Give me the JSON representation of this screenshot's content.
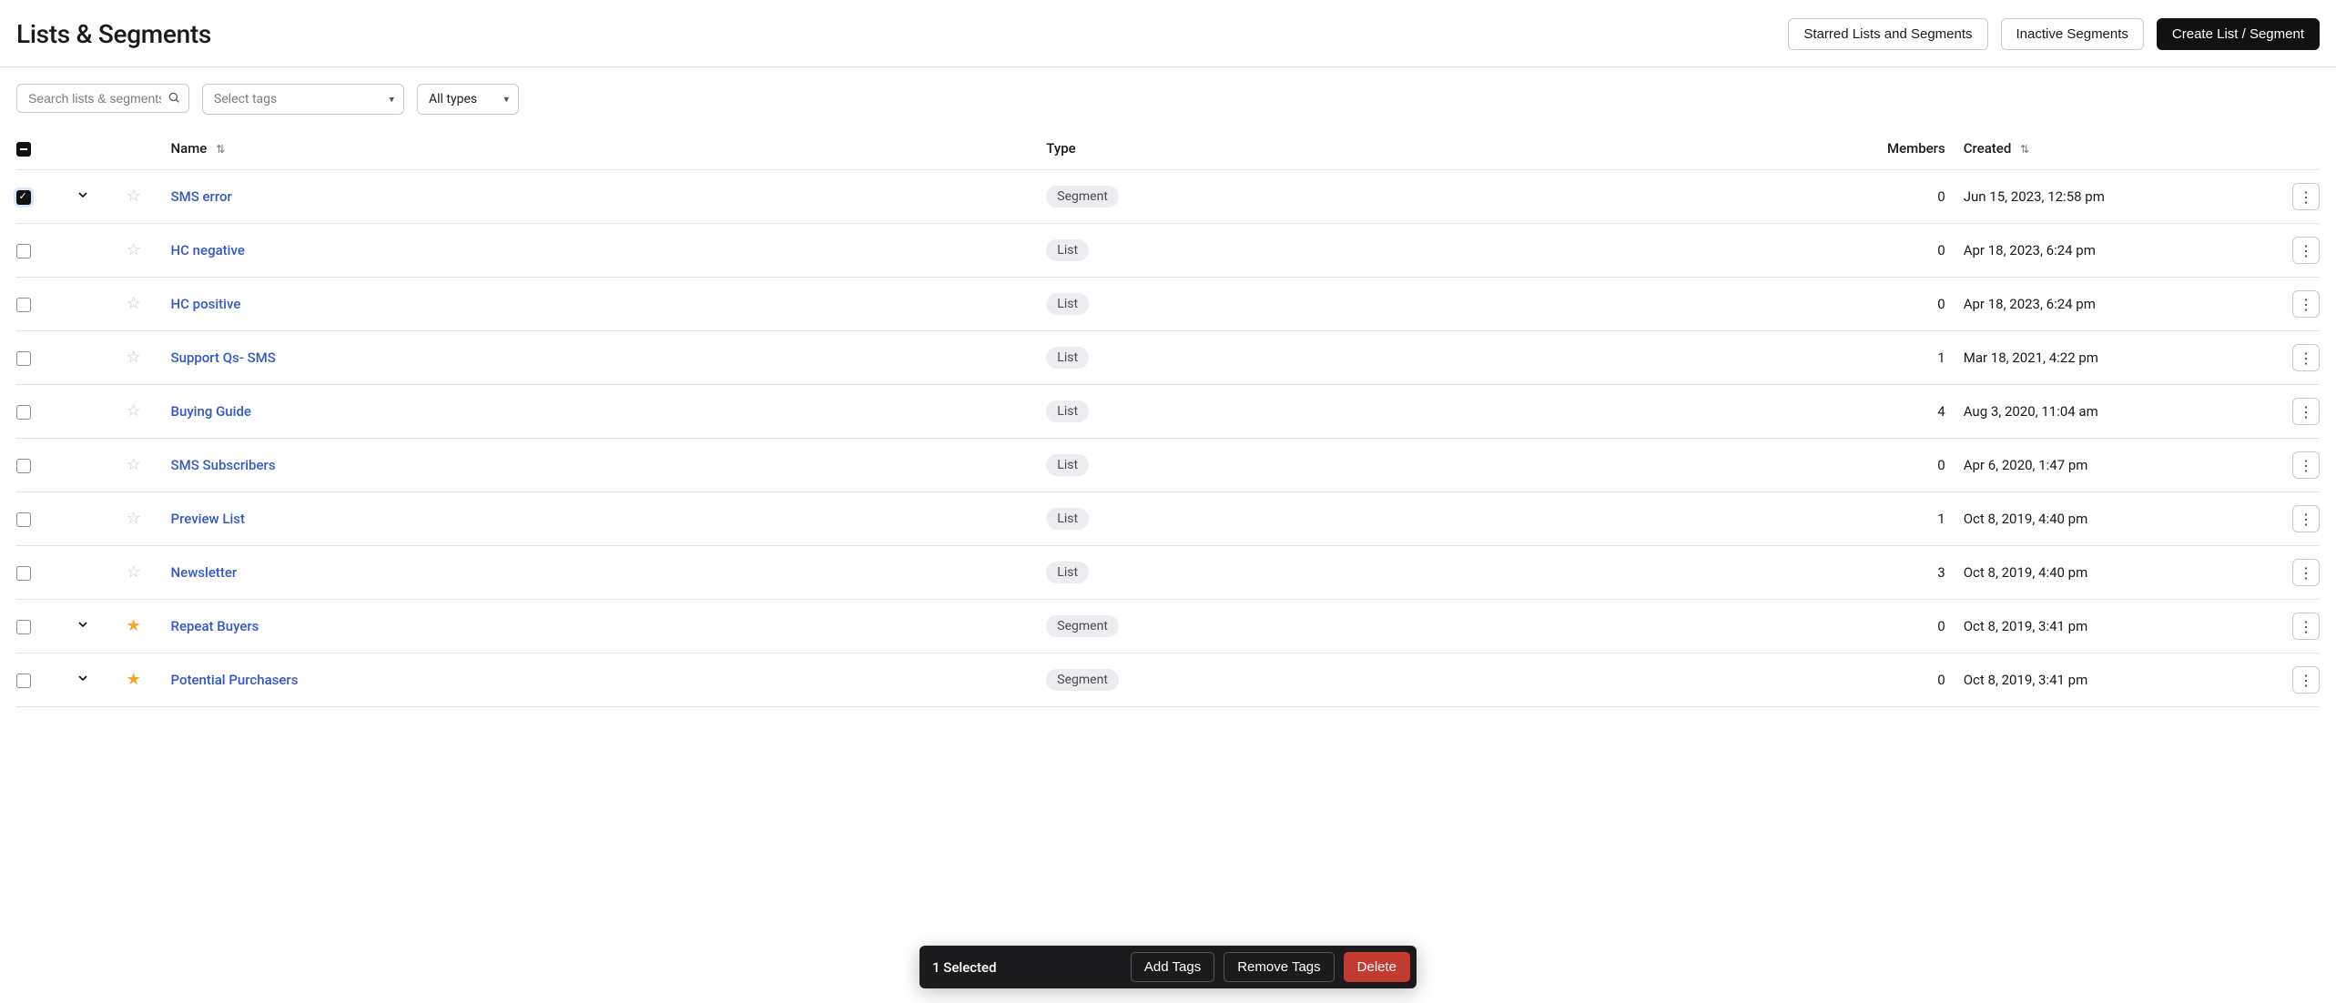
{
  "header": {
    "title": "Lists & Segments",
    "starred_btn": "Starred Lists and Segments",
    "inactive_btn": "Inactive Segments",
    "create_btn": "Create List / Segment"
  },
  "filters": {
    "search_placeholder": "Search lists & segments",
    "tags_placeholder": "Select tags",
    "types_label": "All types"
  },
  "columns": {
    "name": "Name",
    "type": "Type",
    "members": "Members",
    "created": "Created"
  },
  "rows": [
    {
      "selected": true,
      "expandable": true,
      "starred": false,
      "name": "SMS error",
      "type": "Segment",
      "members": "0",
      "created": "Jun 15, 2023, 12:58 pm"
    },
    {
      "selected": false,
      "expandable": false,
      "starred": false,
      "name": "HC negative",
      "type": "List",
      "members": "0",
      "created": "Apr 18, 2023, 6:24 pm"
    },
    {
      "selected": false,
      "expandable": false,
      "starred": false,
      "name": "HC positive",
      "type": "List",
      "members": "0",
      "created": "Apr 18, 2023, 6:24 pm"
    },
    {
      "selected": false,
      "expandable": false,
      "starred": false,
      "name": "Support Qs- SMS",
      "type": "List",
      "members": "1",
      "created": "Mar 18, 2021, 4:22 pm"
    },
    {
      "selected": false,
      "expandable": false,
      "starred": false,
      "name": "Buying Guide",
      "type": "List",
      "members": "4",
      "created": "Aug 3, 2020, 11:04 am"
    },
    {
      "selected": false,
      "expandable": false,
      "starred": false,
      "name": "SMS Subscribers",
      "type": "List",
      "members": "0",
      "created": "Apr 6, 2020, 1:47 pm"
    },
    {
      "selected": false,
      "expandable": false,
      "starred": false,
      "name": "Preview List",
      "type": "List",
      "members": "1",
      "created": "Oct 8, 2019, 4:40 pm"
    },
    {
      "selected": false,
      "expandable": false,
      "starred": false,
      "name": "Newsletter",
      "type": "List",
      "members": "3",
      "created": "Oct 8, 2019, 4:40 pm"
    },
    {
      "selected": false,
      "expandable": true,
      "starred": true,
      "name": "Repeat Buyers",
      "type": "Segment",
      "members": "0",
      "created": "Oct 8, 2019, 3:41 pm"
    },
    {
      "selected": false,
      "expandable": true,
      "starred": true,
      "name": "Potential Purchasers",
      "type": "Segment",
      "members": "0",
      "created": "Oct 8, 2019, 3:41 pm"
    }
  ],
  "action_bar": {
    "status": "1 Selected",
    "add_tags": "Add Tags",
    "remove_tags": "Remove Tags",
    "delete": "Delete"
  }
}
